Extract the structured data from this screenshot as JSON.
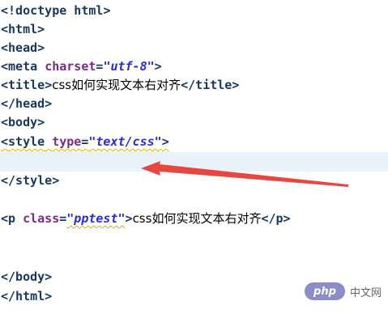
{
  "editor": {
    "lines": {
      "l1": {
        "open": "<",
        "tag": "!doctype html",
        "close": ">"
      },
      "l2": {
        "text": "<html>"
      },
      "l3": {
        "text": "<head>"
      },
      "l4": {
        "open": "<",
        "tag": "meta",
        "sp": " ",
        "attr": "charset",
        "eq": "=",
        "val": "\"utf-8\"",
        "close": ">"
      },
      "l5": {
        "open": "<",
        "tag": "title",
        "close": ">",
        "content": "css如何实现文本右对齐",
        "end": "</title>"
      },
      "l6": {
        "text": "</head>"
      },
      "l7": {
        "text": "<body>"
      },
      "l8": {
        "open": "<",
        "tag": "style",
        "sp": " ",
        "attr": "type",
        "eq": "=",
        "val": "\"text/css\"",
        "close": ">"
      },
      "l9": {
        "text": ""
      },
      "l10": {
        "text": "</style>"
      },
      "l11": {
        "open": "<",
        "tag": "p",
        "sp": " ",
        "attr": "class",
        "eq": "=",
        "val": "\"pptest\"",
        "close": ">",
        "content": "css如何实现文本右对齐",
        "end": "</p>"
      },
      "l12": {
        "text": "</body>"
      },
      "l13": {
        "text": "</html>"
      }
    },
    "current_line_color": "#e9f1fb",
    "arrow_color": "#e8473f"
  },
  "watermark": {
    "logo": "php",
    "site": "中文网"
  }
}
